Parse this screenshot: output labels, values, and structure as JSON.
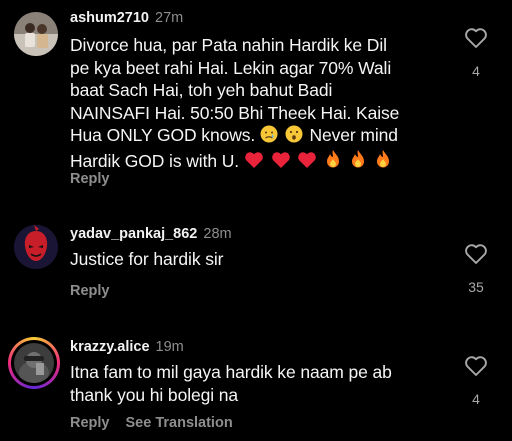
{
  "comments": [
    {
      "username": "ashum2710",
      "time": "27m",
      "text_lines": [
        "Divorce hua, par Pata nahin Hardik ke Dil",
        "pe kya beet rahi Hai. Lekin agar 70% Wali",
        "baat Sach Hai, toh yeh bahut Badi",
        "NAINSAFI Hai. 50:50 Bhi Theek Hai. Kaise",
        "Hua ONLY GOD knows.",
        "Never mind",
        "Hardik GOD is with U."
      ],
      "reply_label": "Reply",
      "likes": "4"
    },
    {
      "username": "yadav_pankaj_862",
      "time": "28m",
      "text_lines": [
        "Justice for hardik sir"
      ],
      "reply_label": "Reply",
      "likes": "35"
    },
    {
      "username": "krazzy.alice",
      "time": "19m",
      "text_lines": [
        "Itna fam to mil gaya hardik ke naam pe ab",
        "thank you hi bolegi na"
      ],
      "reply_label": "Reply",
      "see_translation_label": "See Translation",
      "likes": "4"
    }
  ],
  "icons": {
    "emoji_sequence_1": [
      "crying-face",
      "surprised-face"
    ],
    "emoji_sequence_2": [
      "red-heart",
      "red-heart",
      "red-heart",
      "fire",
      "fire",
      "fire"
    ],
    "like": "heart-outline-icon"
  },
  "colors": {
    "background": "#000000",
    "text": "#f5f5f5",
    "muted": "#8e8e8e",
    "heart": "#e8233a",
    "fire": "#ff7a1a"
  }
}
